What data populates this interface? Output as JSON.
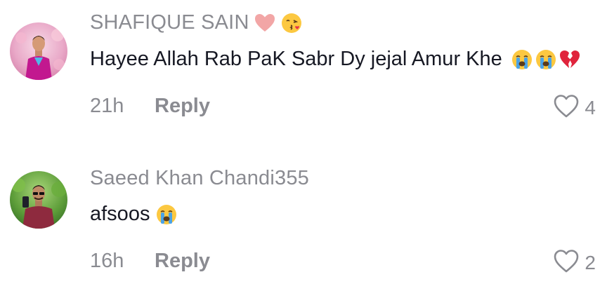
{
  "comments": [
    {
      "username": "SHAFIQUE SAIN",
      "username_emojis": [
        "heart-emoji",
        "kissing-face-emoji"
      ],
      "text": "Hayee Allah Rab PaK Sabr Dy jejal Amur Khe",
      "text_emojis": [
        "crying-face-emoji",
        "crying-face-emoji",
        "broken-heart-emoji"
      ],
      "time": "21h",
      "reply_label": "Reply",
      "likes": "4"
    },
    {
      "username": "Saeed Khan Chandi355",
      "text": "afsoos",
      "text_emojis": [
        "crying-face-emoji"
      ],
      "time": "16h",
      "reply_label": "Reply",
      "likes": "2"
    }
  ],
  "colors": {
    "meta": "#8a8b91",
    "text": "#161823",
    "background": "#ffffff"
  }
}
